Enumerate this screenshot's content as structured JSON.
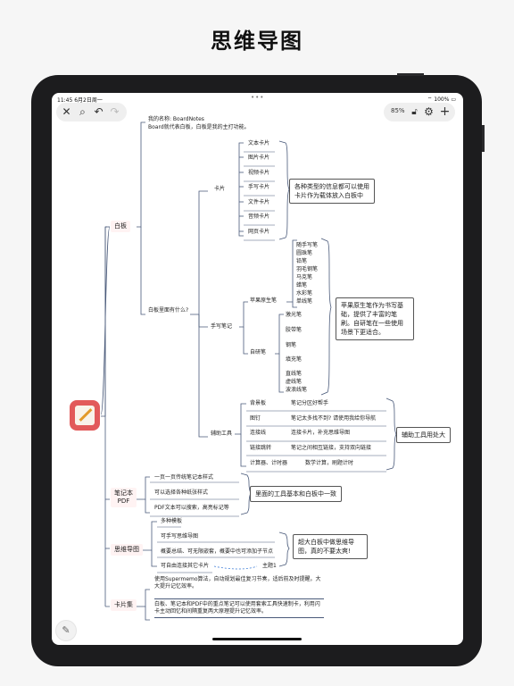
{
  "page": {
    "title": "思维导图"
  },
  "status": {
    "time": "11:45",
    "date": "6月2日周一",
    "dots": "•••",
    "battery": "100%"
  },
  "toolbar": {
    "zoom": "85%",
    "close_icon": "close-icon",
    "search_icon": "search-icon",
    "undo_icon": "undo-icon",
    "redo_icon": "redo-icon",
    "lock_icon": "lock-icon",
    "settings_icon": "gear-icon",
    "add_icon": "plus-icon"
  },
  "mindmap": {
    "intro_1": "我的名称: BoardNotes",
    "intro_2": "Board就代表白板，白板是我的主打功能。",
    "main_nodes": [
      "白板",
      "笔记本\nPDF",
      "思维导图",
      "卡片集"
    ],
    "board_question": "白板里面有什么?",
    "cards": {
      "label": "卡片",
      "items": [
        "文本卡片",
        "图片卡片",
        "视频卡片",
        "手写卡片",
        "文件卡片",
        "音频卡片",
        "网页卡片"
      ],
      "note": "各种类型的信息都可以使用卡片作为载体放入白板中"
    },
    "handwriting": {
      "label": "手写笔记",
      "apple_pen": "苹果原生笔",
      "apple_items": [
        "随手写笔",
        "圆珠笔",
        "铅笔",
        "羽毛钢笔",
        "马克笔",
        "蜡笔",
        "水彩笔",
        "单线笔"
      ],
      "self_pen": "自研笔",
      "self_items": [
        "激光笔",
        "胶带笔",
        "钢笔",
        "填充笔"
      ],
      "line_pens": [
        "直线笔",
        "虚线笔",
        "波浪线笔"
      ],
      "note": "苹果原生笔作为书写基础，提供了丰富的笔刷。自研笔在一些使用场景下更适合。"
    },
    "tools": {
      "label": "辅助工具",
      "rows": [
        {
          "name": "背景板",
          "desc": "笔记分区好帮手"
        },
        {
          "name": "图钉",
          "desc": "笔记太多找不到? 请使用我给你导航"
        },
        {
          "name": "连接线",
          "desc": "连接卡片，补充思维导图"
        },
        {
          "name": "链接跳转",
          "desc": "笔记之间相互链接，支持双向链接"
        },
        {
          "name": "计算器、计时器",
          "desc": "数学计算，刷题计时"
        }
      ],
      "note": "辅助工具用处大"
    },
    "notebook": {
      "items": [
        "一页一页传统笔记本样式",
        "可以选择各种纸张样式",
        "PDF文本可以搜索，高亮标记等"
      ],
      "note": "里面的工具基本和白板中一致"
    },
    "mindmap_node": {
      "items": [
        "多种模板",
        "可手写思维导图",
        "概要总结、可无限嵌套，概要中也可添加子节点",
        "可自由连接其它卡片"
      ],
      "topic": "主题1",
      "note": "超大白板中做思维导图，真的不要太爽!"
    },
    "cardset": {
      "line1": "使用Supermemo算法，自动规划最佳复习节奏，适后前及时提醒。大大提升记忆效率。",
      "line2": "白板、笔记本和PDF中的重点笔记可以使用套索工具快速制卡，利用闪卡主动回忆和间隔重复两大原理提升记忆效率。"
    }
  },
  "colors": {
    "accent_red": "#e25a5a",
    "node_bg": "#fff3f3",
    "line": "#4a5a7a"
  }
}
